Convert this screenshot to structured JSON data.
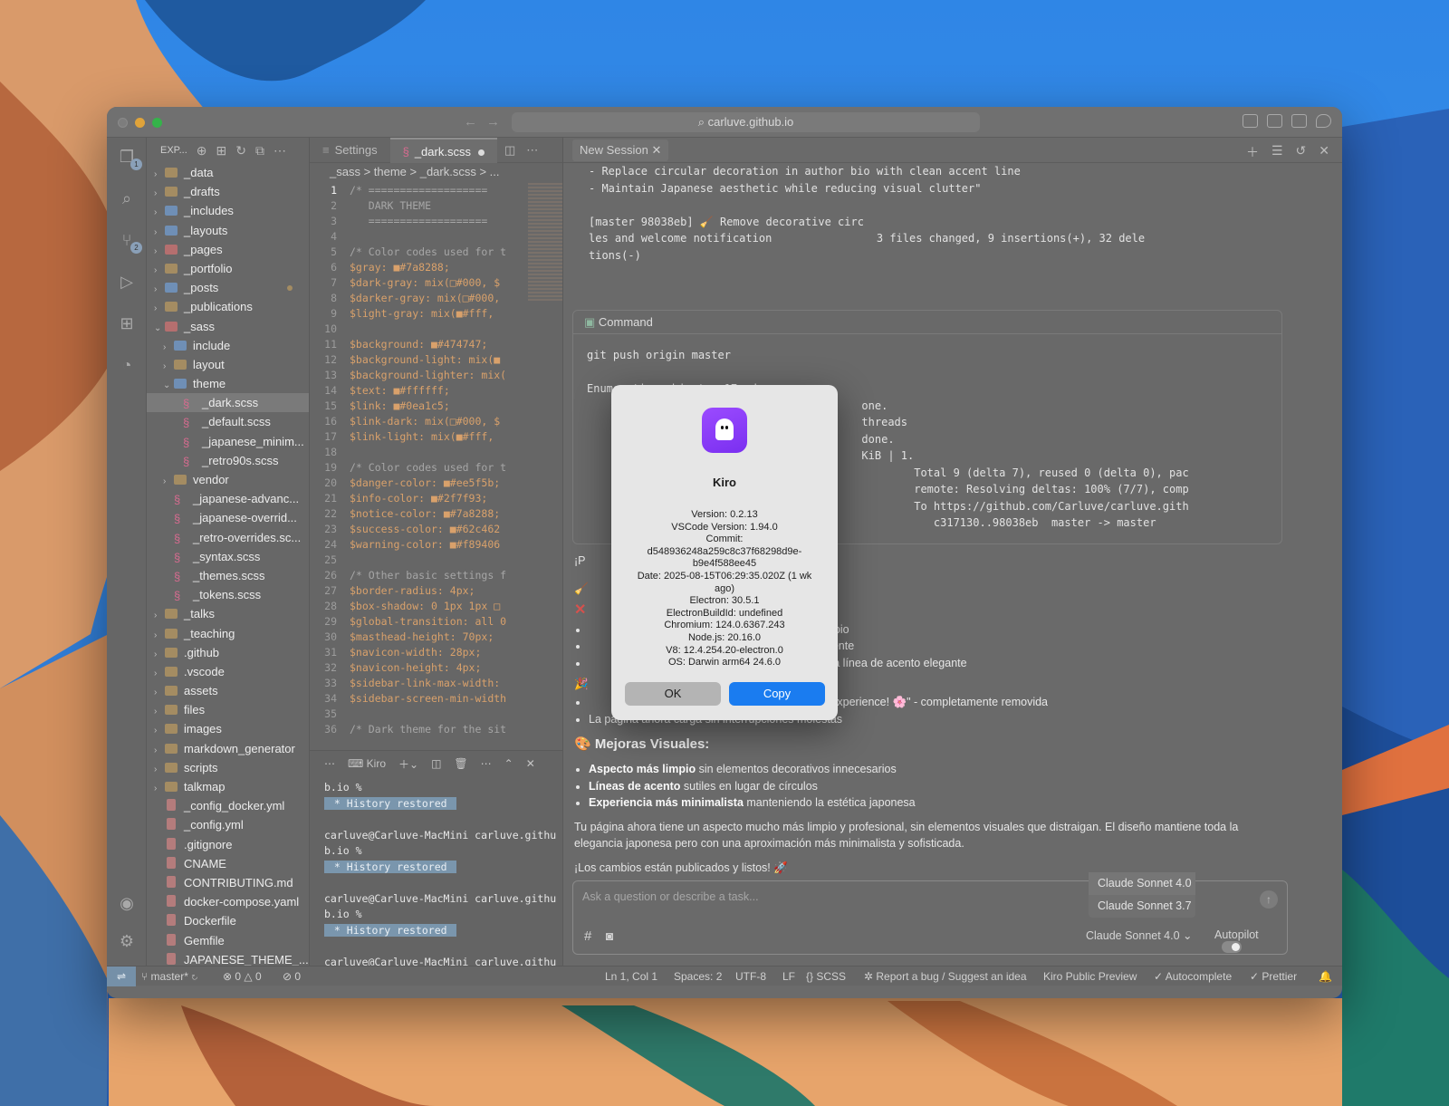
{
  "titlebar": {
    "url": "carluve.github.io"
  },
  "explorer": {
    "header": "EXP...",
    "items": [
      {
        "name": "_data",
        "kind": "folder",
        "depth": 0,
        "open": false
      },
      {
        "name": "_drafts",
        "kind": "folder",
        "depth": 0,
        "open": false
      },
      {
        "name": "_includes",
        "kind": "folder",
        "depth": 0,
        "open": false
      },
      {
        "name": "_layouts",
        "kind": "folder",
        "depth": 0,
        "open": false
      },
      {
        "name": "_pages",
        "kind": "folder",
        "depth": 0,
        "open": false
      },
      {
        "name": "_portfolio",
        "kind": "folder",
        "depth": 0,
        "open": false
      },
      {
        "name": "_posts",
        "kind": "folder",
        "depth": 0,
        "open": false,
        "modified": true
      },
      {
        "name": "_publications",
        "kind": "folder",
        "depth": 0,
        "open": false
      },
      {
        "name": "_sass",
        "kind": "folder",
        "depth": 0,
        "open": true
      },
      {
        "name": "include",
        "kind": "folder",
        "depth": 1,
        "open": false
      },
      {
        "name": "layout",
        "kind": "folder",
        "depth": 1,
        "open": false
      },
      {
        "name": "theme",
        "kind": "folder",
        "depth": 1,
        "open": true
      },
      {
        "name": "_dark.scss",
        "kind": "scss",
        "depth": 2,
        "selected": true
      },
      {
        "name": "_default.scss",
        "kind": "scss",
        "depth": 2
      },
      {
        "name": "_japanese_minim...",
        "kind": "scss",
        "depth": 2
      },
      {
        "name": "_retro90s.scss",
        "kind": "scss",
        "depth": 2
      },
      {
        "name": "vendor",
        "kind": "folder",
        "depth": 1,
        "open": false
      },
      {
        "name": "_japanese-advanc...",
        "kind": "scss",
        "depth": 1
      },
      {
        "name": "_japanese-overrid...",
        "kind": "scss",
        "depth": 1
      },
      {
        "name": "_retro-overrides.sc...",
        "kind": "scss",
        "depth": 1
      },
      {
        "name": "_syntax.scss",
        "kind": "scss",
        "depth": 1
      },
      {
        "name": "_themes.scss",
        "kind": "scss",
        "depth": 1
      },
      {
        "name": "_tokens.scss",
        "kind": "scss",
        "depth": 1
      },
      {
        "name": "_talks",
        "kind": "folder",
        "depth": 0,
        "open": false
      },
      {
        "name": "_teaching",
        "kind": "folder",
        "depth": 0,
        "open": false
      },
      {
        "name": ".github",
        "kind": "folder",
        "depth": 0,
        "open": false
      },
      {
        "name": ".vscode",
        "kind": "folder",
        "depth": 0,
        "open": false
      },
      {
        "name": "assets",
        "kind": "folder",
        "depth": 0,
        "open": false
      },
      {
        "name": "files",
        "kind": "folder",
        "depth": 0,
        "open": false
      },
      {
        "name": "images",
        "kind": "folder",
        "depth": 0,
        "open": false
      },
      {
        "name": "markdown_generator",
        "kind": "folder",
        "depth": 0,
        "open": false
      },
      {
        "name": "scripts",
        "kind": "folder",
        "depth": 0,
        "open": false
      },
      {
        "name": "talkmap",
        "kind": "folder",
        "depth": 0,
        "open": false
      },
      {
        "name": "_config_docker.yml",
        "kind": "file",
        "depth": 0
      },
      {
        "name": "_config.yml",
        "kind": "file",
        "depth": 0
      },
      {
        "name": ".gitignore",
        "kind": "file",
        "depth": 0
      },
      {
        "name": "CNAME",
        "kind": "file",
        "depth": 0
      },
      {
        "name": "CONTRIBUTING.md",
        "kind": "file",
        "depth": 0
      },
      {
        "name": "docker-compose.yaml",
        "kind": "file",
        "depth": 0
      },
      {
        "name": "Dockerfile",
        "kind": "file",
        "depth": 0
      },
      {
        "name": "Gemfile",
        "kind": "file",
        "depth": 0
      },
      {
        "name": "JAPANESE_THEME_...",
        "kind": "file",
        "depth": 0
      }
    ]
  },
  "editor": {
    "tabs": [
      {
        "label": "Settings",
        "active": false
      },
      {
        "label": "_dark.scss",
        "active": true,
        "dirty": true
      }
    ],
    "breadcrumb": "_sass > theme > _dark.scss > ...",
    "lines": [
      "/* ===================",
      "   DARK THEME",
      "   ===================",
      "",
      "/* Color codes used for t",
      "$gray: ■#7a8288;",
      "$dark-gray: mix(□#000, $",
      "$darker-gray: mix(□#000,",
      "$light-gray: mix(■#fff,",
      "",
      "$background: ■#474747;",
      "$background-light: mix(■",
      "$background-lighter: mix(",
      "$text: ■#ffffff;",
      "$link: ■#0ea1c5;",
      "$link-dark: mix(□#000, $",
      "$link-light: mix(■#fff,",
      "",
      "/* Color codes used for t",
      "$danger-color: ■#ee5f5b;",
      "$info-color: ■#2f7f93;",
      "$notice-color: ■#7a8288;",
      "$success-color: ■#62c462",
      "$warning-color: ■#f89406",
      "",
      "/* Other basic settings f",
      "$border-radius: 4px;",
      "$box-shadow: 0 1px 1px □",
      "$global-transition: all 0",
      "$masthead-height: 70px;",
      "$navicon-width: 28px;",
      "$navicon-height: 4px;",
      "$sidebar-link-max-width:",
      "$sidebar-screen-min-width",
      "",
      "/* Dark theme for the sit"
    ]
  },
  "terminal": {
    "tab": "Kiro",
    "lines": [
      {
        "text": "b.io %",
        "hl": false
      },
      {
        "text": " * History restored ",
        "hl": true
      },
      {
        "text": "",
        "hl": false
      },
      {
        "text": "carluve@Carluve-MacMini carluve.githu",
        "hl": false
      },
      {
        "text": "b.io %",
        "hl": false
      },
      {
        "text": " * History restored ",
        "hl": true
      },
      {
        "text": "",
        "hl": false
      },
      {
        "text": "carluve@Carluve-MacMini carluve.githu",
        "hl": false
      },
      {
        "text": "b.io %",
        "hl": false
      },
      {
        "text": " * History restored ",
        "hl": true
      },
      {
        "text": "",
        "hl": false
      },
      {
        "text": "carluve@Carluve-MacMini carluve.githu",
        "hl": false
      },
      {
        "text": "b.i",
        "hl": false
      },
      {
        "text": "carluve@Carluve-MacMini carluve.githu",
        "hl": false
      },
      {
        "text": "b.io %",
        "hl": false
      }
    ]
  },
  "chat": {
    "tab": "New Session",
    "commit_output": [
      "- Replace circular decoration in author bio with clean accent line",
      "- Maintain Japanese aesthetic while reducing visual clutter\"",
      "",
      "[master 98038eb] 🧹 Remove decorative circ",
      "les and welcome notification                3 files changed, 9 insertions(+), 32 dele",
      "tions(-)"
    ],
    "command_title": "Command",
    "command_lines": [
      "git push origin master",
      "",
      "Enumerating objects: 17, done.",
      "                                          one.",
      "                                          threads",
      "                                          done.",
      "                                          KiB | 1.",
      "                                                  Total 9 (delta 7), reused 0 (delta 0), pac",
      "                                                  remote: Resolving deltas: 100% (7/7), comp",
      "                                                  To https://github.com/Carluve/carluve.gith",
      "                                                     c317130..98038eb  master -> master"
    ],
    "intro": "¡P                                        os que pediste:",
    "bullets1": [
      "                                               un aspecto más limpio",
      "                                               minado completamente",
      "                                               eemplazada por una línea de acento elegante"
    ],
    "bullets2": [
      "                                               Japanese minimal experience! 🌸\" - completamente removida",
      "La página ahora carga sin interrupciones molestas"
    ],
    "heading": "🎨 Mejoras Visuales:",
    "improvements": [
      {
        "bold": "Aspecto más limpio",
        "rest": " sin elementos decorativos innecesarios"
      },
      {
        "bold": "Líneas de acento",
        "rest": " sutiles en lugar de círculos"
      },
      {
        "bold": "Experiencia más minimalista",
        "rest": " manteniendo la estética japonesa"
      }
    ],
    "summary": "Tu página ahora tiene un aspecto mucho más limpio y profesional, sin elementos visuales que distraigan. El diseño mantiene toda la elegancia japonesa pero con una aproximación más minimalista y sofisticada.",
    "closing": "¡Los cambios están publicados y listos! 🚀",
    "input_placeholder": "Ask a question or describe a task...",
    "model_options": [
      "Claude Sonnet 4.0",
      "Claude Sonnet 3.7"
    ],
    "selected_model": "Claude Sonnet 4.0",
    "autopilot_label": "Autopilot"
  },
  "statusbar": {
    "branch": "master*",
    "errors": "0",
    "warnings": "0",
    "ports": "0",
    "position": "Ln 1, Col 1",
    "spaces": "Spaces: 2",
    "encoding": "UTF-8",
    "eol": "LF",
    "language": "SCSS",
    "report": "Report a bug / Suggest an idea",
    "preview": "Kiro Public Preview",
    "autocomplete": "Autocomplete",
    "prettier": "Prettier"
  },
  "about_dialog": {
    "title": "Kiro",
    "info": [
      "Version: 0.2.13",
      "VSCode Version: 1.94.0",
      "Commit:",
      "d548936248a259c8c37f68298d9e-b9e4f588ee45",
      "Date: 2025-08-15T06:29:35.020Z (1 wk ago)",
      "Electron: 30.5.1",
      "ElectronBuildId: undefined",
      "Chromium: 124.0.6367.243",
      "Node.js: 20.16.0",
      "V8: 12.4.254.20-electron.0",
      "OS: Darwin arm64 24.6.0"
    ],
    "ok_label": "OK",
    "copy_label": "Copy",
    "icon": "ghost-icon"
  },
  "colors": {
    "accent": "#1a7cf0",
    "app_icon": "#8a3cf7",
    "scss": "#d66b8f"
  }
}
